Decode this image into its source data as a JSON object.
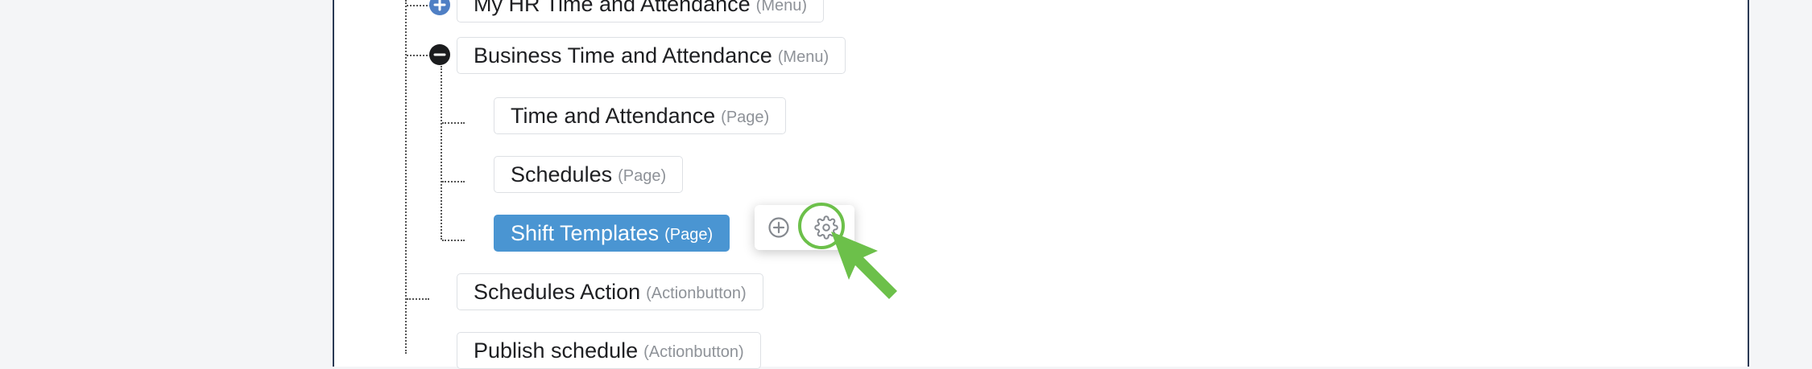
{
  "tree": {
    "nodes": [
      {
        "name": "My HR Time and Attendance",
        "type": "(Menu)"
      },
      {
        "name": "Business Time and Attendance",
        "type": "(Menu)"
      },
      {
        "name": "Time and Attendance",
        "type": "(Page)"
      },
      {
        "name": "Schedules",
        "type": "(Page)"
      },
      {
        "name": "Shift Templates",
        "type": "(Page)"
      },
      {
        "name": "Schedules Action",
        "type": "(Actionbutton)"
      },
      {
        "name": "Publish schedule",
        "type": "(Actionbutton)"
      }
    ],
    "selected_node": "Shift Templates"
  },
  "popover": {
    "actions": [
      "add-child-icon",
      "settings-gear-icon"
    ]
  },
  "colors": {
    "selected": "#4a95d2",
    "highlight": "#6cc04a",
    "expand_toggle": "#4f7fc4",
    "collapse_toggle": "#1b1c1e"
  }
}
